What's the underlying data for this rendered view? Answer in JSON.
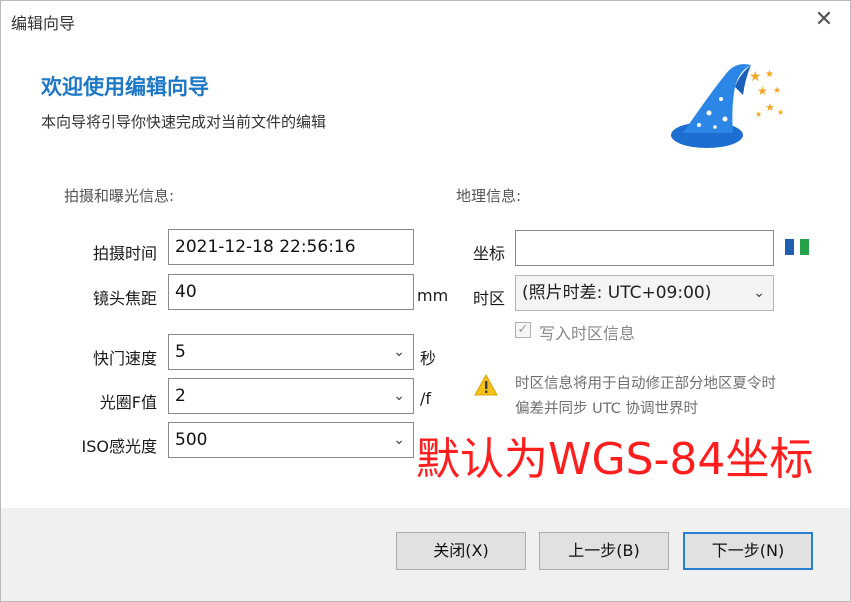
{
  "window": {
    "title": "编辑向导",
    "close_glyph": "✕"
  },
  "header": {
    "title": "欢迎使用编辑向导",
    "subtitle": "本向导将引导你快速完成对当前文件的编辑",
    "icon": "wizard-hat-icon"
  },
  "exposure": {
    "group_label": "拍摄和曝光信息:",
    "shot_time_label": "拍摄时间",
    "shot_time_value": "2021-12-18 22:56:16",
    "focal_label": "镜头焦距",
    "focal_value": "40",
    "focal_unit": "mm",
    "shutter_label": "快门速度",
    "shutter_value": "5",
    "shutter_unit": "秒",
    "aperture_label": "光圈F值",
    "aperture_value": "2",
    "aperture_unit": "/f",
    "iso_label": "ISO感光度",
    "iso_value": "500"
  },
  "geo": {
    "group_label": "地理信息:",
    "coord_label": "坐标",
    "coord_value": "",
    "timezone_label": "时区",
    "timezone_value": "(照片时差: UTC+09:00)",
    "write_tz_label": "写入时区信息",
    "write_tz_checked": true,
    "note_line1": "时区信息将用于自动修正部分地区夏令时",
    "note_line2": "偏差并同步 UTC 协调世界时"
  },
  "overlay_text": "默认为WGS-84坐标",
  "buttons": {
    "close": "关闭(X)",
    "prev": "上一步(B)",
    "next": "下一步(N)"
  },
  "colors": {
    "accent": "#1e78c8",
    "overlay": "#ff1e1e",
    "default_border": "#2a7fd4"
  }
}
